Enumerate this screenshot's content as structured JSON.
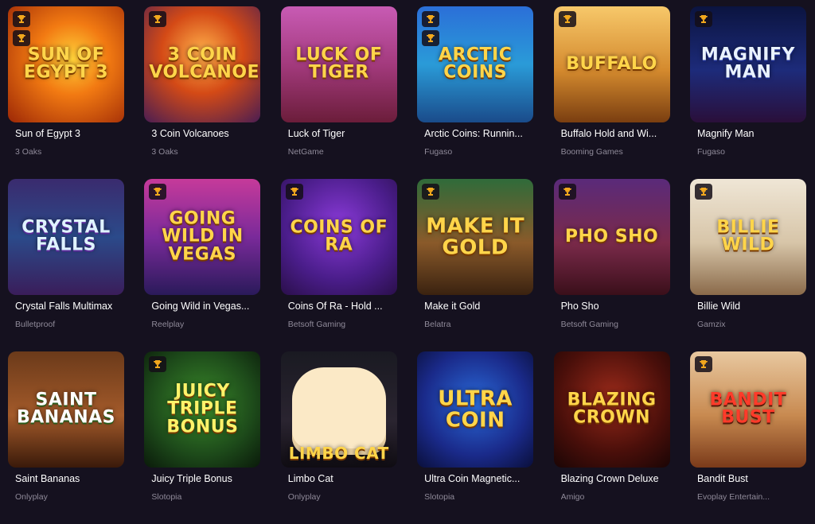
{
  "games": [
    {
      "title": "Sun of Egypt 3",
      "provider": "3 Oaks",
      "logo": "SUN OF EGYPT 3",
      "badges": [
        "cup-icon",
        "cup-icon"
      ]
    },
    {
      "title": "3 Coin Volcanoes",
      "provider": "3 Oaks",
      "logo": "3 COIN VOLCANOES",
      "badges": [
        "cup-icon"
      ]
    },
    {
      "title": "Luck of Tiger",
      "provider": "NetGame",
      "logo": "LUCK OF TIGER",
      "badges": []
    },
    {
      "title": "Arctic Coins: Runnin...",
      "provider": "Fugaso",
      "logo": "ARCTIC COINS",
      "badges": [
        "cup-icon",
        "cup-icon"
      ]
    },
    {
      "title": "Buffalo Hold and Wi...",
      "provider": "Booming Games",
      "logo": "BUFFALO",
      "badges": [
        "cup-icon"
      ]
    },
    {
      "title": "Magnify Man",
      "provider": "Fugaso",
      "logo": "MAGNIFY MAN",
      "badges": [
        "cup-icon"
      ]
    },
    {
      "title": "Crystal Falls Multimax",
      "provider": "Bulletproof",
      "logo": "CRYSTAL FALLS",
      "badges": []
    },
    {
      "title": "Going Wild in Vegas...",
      "provider": "Reelplay",
      "logo": "GOING WILD IN VEGAS",
      "badges": [
        "cup-icon"
      ]
    },
    {
      "title": "Coins Of Ra - Hold ...",
      "provider": "Betsoft Gaming",
      "logo": "COINS OF RA",
      "badges": [
        "cup-icon"
      ]
    },
    {
      "title": "Make it Gold",
      "provider": "Belatra",
      "logo": "MAKE IT GOLD",
      "badges": [
        "cup-icon"
      ]
    },
    {
      "title": "Pho Sho",
      "provider": "Betsoft Gaming",
      "logo": "PHO SHO",
      "badges": [
        "cup-icon"
      ]
    },
    {
      "title": "Billie Wild",
      "provider": "Gamzix",
      "logo": "BILLIE WILD",
      "badges": [
        "cup-icon"
      ]
    },
    {
      "title": "Saint Bananas",
      "provider": "Onlyplay",
      "logo": "SAINT BANANAS",
      "badges": []
    },
    {
      "title": "Juicy Triple Bonus",
      "provider": "Slotopia",
      "logo": "JUICY TRIPLE BONUS",
      "badges": [
        "cup-icon"
      ]
    },
    {
      "title": "Limbo Cat",
      "provider": "Onlyplay",
      "logo": "LIMBO CAT",
      "badges": []
    },
    {
      "title": "Ultra Coin Magnetic...",
      "provider": "Slotopia",
      "logo": "ULTRA COIN",
      "badges": []
    },
    {
      "title": "Blazing Crown Deluxe",
      "provider": "Amigo",
      "logo": "BLAZING CROWN",
      "badges": []
    },
    {
      "title": "Bandit Bust",
      "provider": "Evoplay Entertain...",
      "logo": "BANDIT BUST",
      "badges": [
        "cup-icon"
      ]
    }
  ],
  "colors": {
    "background": "#15111f",
    "title": "#ffffff",
    "provider": "#8f8a99",
    "badge_icon": "#f2a81d"
  }
}
